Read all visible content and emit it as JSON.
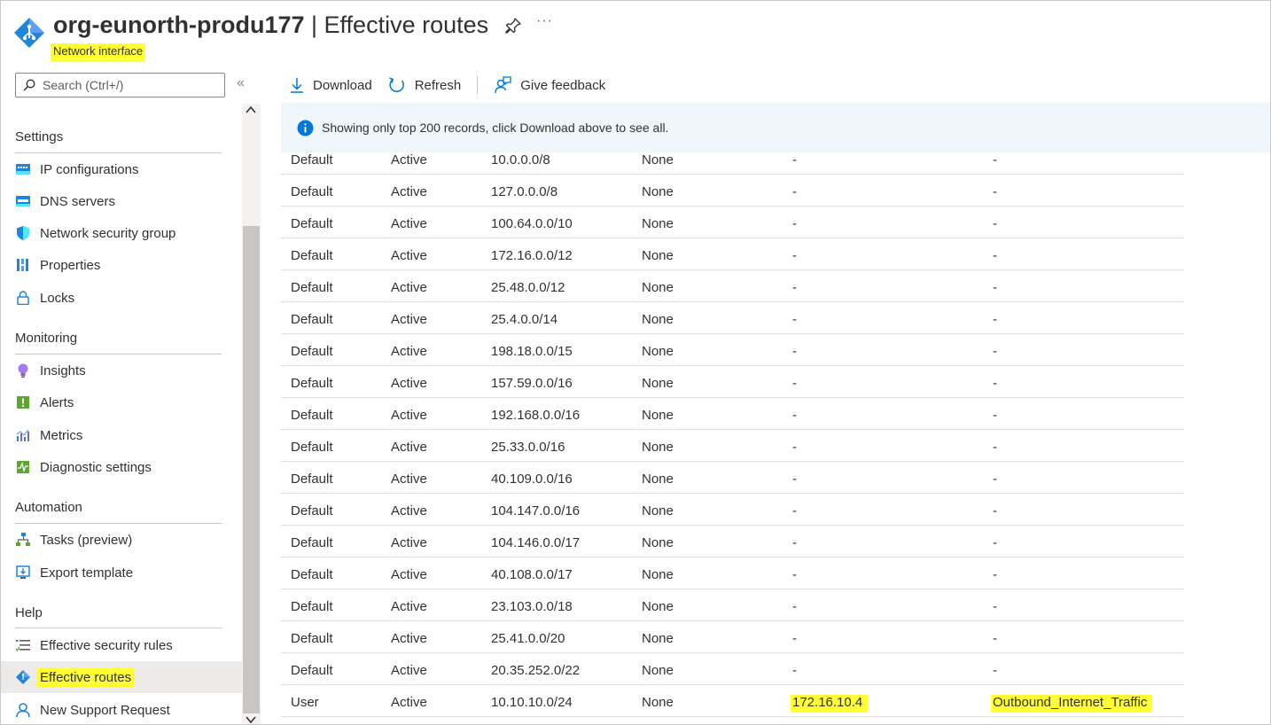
{
  "header": {
    "resource_name": "org-eunorth-produ177",
    "separator": " | ",
    "page_title": "Effective routes",
    "resource_type": "Network interface",
    "more_label": "···"
  },
  "sidebar": {
    "search_placeholder": "Search (Ctrl+/)",
    "collapse_label": "«",
    "sections": [
      {
        "title": "Settings",
        "items": [
          {
            "label": "IP configurations",
            "icon": "ip-config-icon"
          },
          {
            "label": "DNS servers",
            "icon": "dns-icon"
          },
          {
            "label": "Network security group",
            "icon": "shield-icon"
          },
          {
            "label": "Properties",
            "icon": "properties-icon"
          },
          {
            "label": "Locks",
            "icon": "lock-icon"
          }
        ]
      },
      {
        "title": "Monitoring",
        "items": [
          {
            "label": "Insights",
            "icon": "bulb-icon"
          },
          {
            "label": "Alerts",
            "icon": "alert-icon"
          },
          {
            "label": "Metrics",
            "icon": "metrics-icon"
          },
          {
            "label": "Diagnostic settings",
            "icon": "diagnostic-icon"
          }
        ]
      },
      {
        "title": "Automation",
        "items": [
          {
            "label": "Tasks (preview)",
            "icon": "tasks-icon"
          },
          {
            "label": "Export template",
            "icon": "export-icon"
          }
        ]
      },
      {
        "title": "Help",
        "items": [
          {
            "label": "Effective security rules",
            "icon": "security-rules-icon"
          },
          {
            "label": "Effective routes",
            "icon": "routes-icon",
            "selected": true
          },
          {
            "label": "New Support Request",
            "icon": "support-icon"
          }
        ]
      }
    ]
  },
  "toolbar": {
    "download": "Download",
    "refresh": "Refresh",
    "feedback": "Give feedback"
  },
  "info": {
    "message": "Showing only top 200 records, click Download above to see all."
  },
  "routes": [
    [
      "Default",
      "Active",
      "10.0.0.0/8",
      "None",
      "-",
      "-"
    ],
    [
      "Default",
      "Active",
      "127.0.0.0/8",
      "None",
      "-",
      "-"
    ],
    [
      "Default",
      "Active",
      "100.64.0.0/10",
      "None",
      "-",
      "-"
    ],
    [
      "Default",
      "Active",
      "172.16.0.0/12",
      "None",
      "-",
      "-"
    ],
    [
      "Default",
      "Active",
      "25.48.0.0/12",
      "None",
      "-",
      "-"
    ],
    [
      "Default",
      "Active",
      "25.4.0.0/14",
      "None",
      "-",
      "-"
    ],
    [
      "Default",
      "Active",
      "198.18.0.0/15",
      "None",
      "-",
      "-"
    ],
    [
      "Default",
      "Active",
      "157.59.0.0/16",
      "None",
      "-",
      "-"
    ],
    [
      "Default",
      "Active",
      "192.168.0.0/16",
      "None",
      "-",
      "-"
    ],
    [
      "Default",
      "Active",
      "25.33.0.0/16",
      "None",
      "-",
      "-"
    ],
    [
      "Default",
      "Active",
      "40.109.0.0/16",
      "None",
      "-",
      "-"
    ],
    [
      "Default",
      "Active",
      "104.147.0.0/16",
      "None",
      "-",
      "-"
    ],
    [
      "Default",
      "Active",
      "104.146.0.0/17",
      "None",
      "-",
      "-"
    ],
    [
      "Default",
      "Active",
      "40.108.0.0/17",
      "None",
      "-",
      "-"
    ],
    [
      "Default",
      "Active",
      "23.103.0.0/18",
      "None",
      "-",
      "-"
    ],
    [
      "Default",
      "Active",
      "25.41.0.0/20",
      "None",
      "-",
      "-"
    ],
    [
      "Default",
      "Active",
      "20.35.252.0/22",
      "None",
      "-",
      "-"
    ],
    [
      "User",
      "Active",
      "10.10.10.0/24",
      "None",
      "172.16.10.4",
      "Outbound_Internet_Traffic"
    ]
  ],
  "colors": {
    "highlight": "#ffff33",
    "accent": "#0078d4",
    "info_bg": "#eff6fc"
  }
}
